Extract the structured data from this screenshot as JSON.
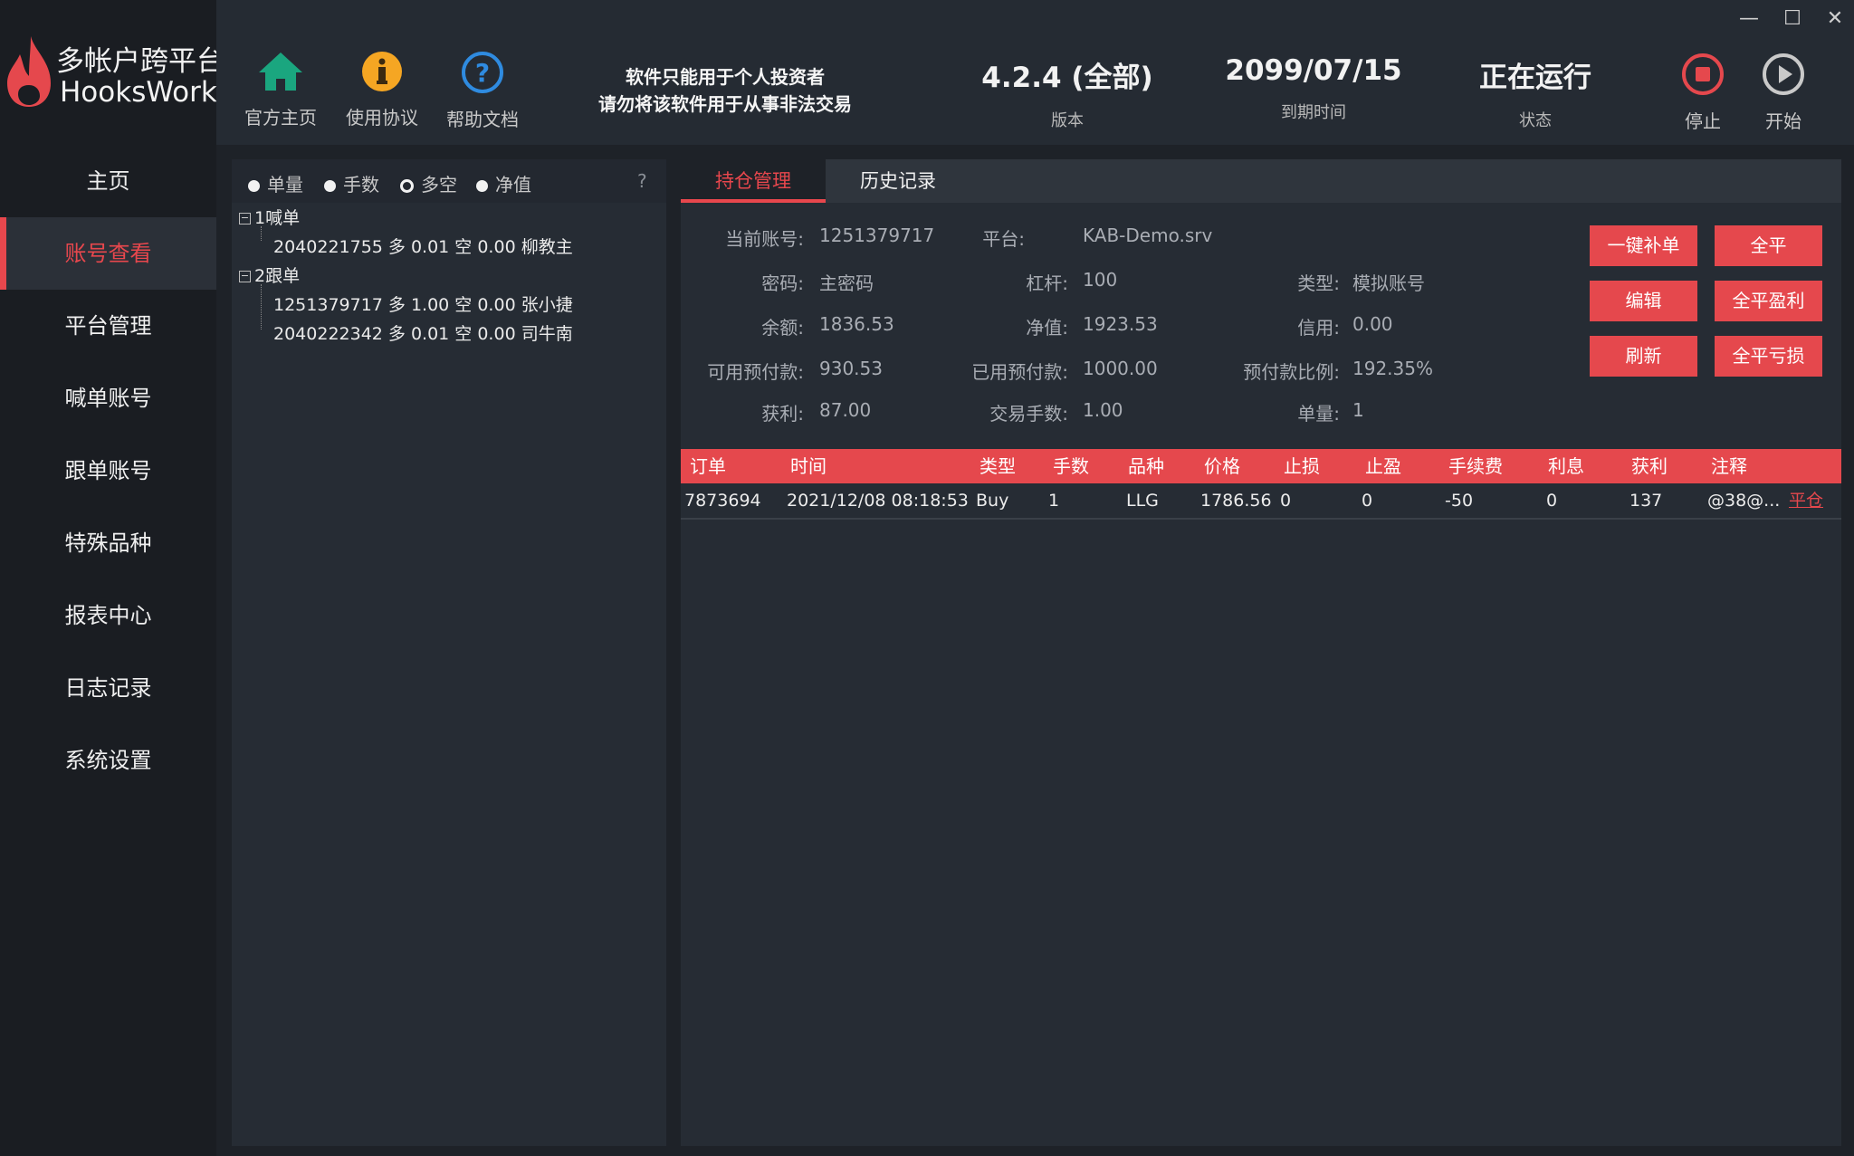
{
  "brand": {
    "line1": "多帐户跨平台",
    "line2": "HooksWork"
  },
  "sidebar": {
    "items": [
      {
        "label": "主页"
      },
      {
        "label": "账号查看"
      },
      {
        "label": "平台管理"
      },
      {
        "label": "喊单账号"
      },
      {
        "label": "跟单账号"
      },
      {
        "label": "特殊品种"
      },
      {
        "label": "报表中心"
      },
      {
        "label": "日志记录"
      },
      {
        "label": "系统设置"
      }
    ],
    "active_index": 1
  },
  "header": {
    "buttons": [
      {
        "label": "官方主页",
        "icon": "home-icon"
      },
      {
        "label": "使用协议",
        "icon": "info-icon"
      },
      {
        "label": "帮助文档",
        "icon": "help-icon"
      }
    ],
    "notice_line1": "软件只能用于个人投资者",
    "notice_line2": "请勿将该软件用于从事非法交易",
    "version": {
      "value": "4.2.4 (全部)",
      "label": "版本"
    },
    "expiry": {
      "value": "2099/07/15",
      "label": "到期时间"
    },
    "status": {
      "value": "正在运行",
      "label": "状态"
    },
    "stop_label": "停止",
    "start_label": "开始",
    "colors": {
      "home": "#1aa67f",
      "info": "#f5a623",
      "help": "#2f8be0",
      "stop": "#e5484d"
    }
  },
  "filters": {
    "options": [
      "单量",
      "手数",
      "多空",
      "净值"
    ],
    "selected": "多空",
    "help": "?"
  },
  "tree": {
    "groups": [
      {
        "title": "1喊单",
        "children": [
          "2040221755 多 0.01 空 0.00 柳教主"
        ]
      },
      {
        "title": "2跟单",
        "children": [
          "1251379717 多 1.00 空 0.00 张小捷",
          "2040222342 多 0.01 空 0.00 司牛南"
        ]
      }
    ]
  },
  "tabs": [
    {
      "label": "持仓管理"
    },
    {
      "label": "历史记录"
    }
  ],
  "account": {
    "current_account": {
      "k": "当前账号:",
      "v": "1251379717"
    },
    "platform": {
      "k": "平台:",
      "v": "KAB-Demo.srv"
    },
    "password": {
      "k": "密码:",
      "v": "主密码"
    },
    "leverage": {
      "k": "杠杆:",
      "v": "100"
    },
    "type": {
      "k": "类型:",
      "v": "模拟账号"
    },
    "balance": {
      "k": "余额:",
      "v": "1836.53"
    },
    "equity": {
      "k": "净值:",
      "v": "1923.53"
    },
    "credit": {
      "k": "信用:",
      "v": "0.00"
    },
    "free_margin": {
      "k": "可用预付款:",
      "v": "930.53"
    },
    "used_margin": {
      "k": "已用预付款:",
      "v": "1000.00"
    },
    "margin_ratio": {
      "k": "预付款比例:",
      "v": "192.35%"
    },
    "profit": {
      "k": "获利:",
      "v": "87.00"
    },
    "lots": {
      "k": "交易手数:",
      "v": "1.00"
    },
    "orders": {
      "k": "单量:",
      "v": "1"
    }
  },
  "actions": {
    "one_click_fill": "一键补单",
    "close_all": "全平",
    "edit": "编辑",
    "close_all_profit": "全平盈利",
    "refresh": "刷新",
    "close_all_loss": "全平亏损"
  },
  "table": {
    "columns": [
      "订单",
      "时间",
      "类型",
      "手数",
      "品种",
      "价格",
      "止损",
      "止盈",
      "手续费",
      "利息",
      "获利",
      "注释"
    ],
    "rows": [
      {
        "order": "7873694",
        "time": "2021/12/08 08:18:53",
        "type": "Buy",
        "lots": "1",
        "symbol": "LLG",
        "price": "1786.56",
        "sl": "0",
        "tp": "0",
        "fee": "-50",
        "swap": "0",
        "profit": "137",
        "comment": "@38@...",
        "action": "平仓"
      }
    ]
  }
}
